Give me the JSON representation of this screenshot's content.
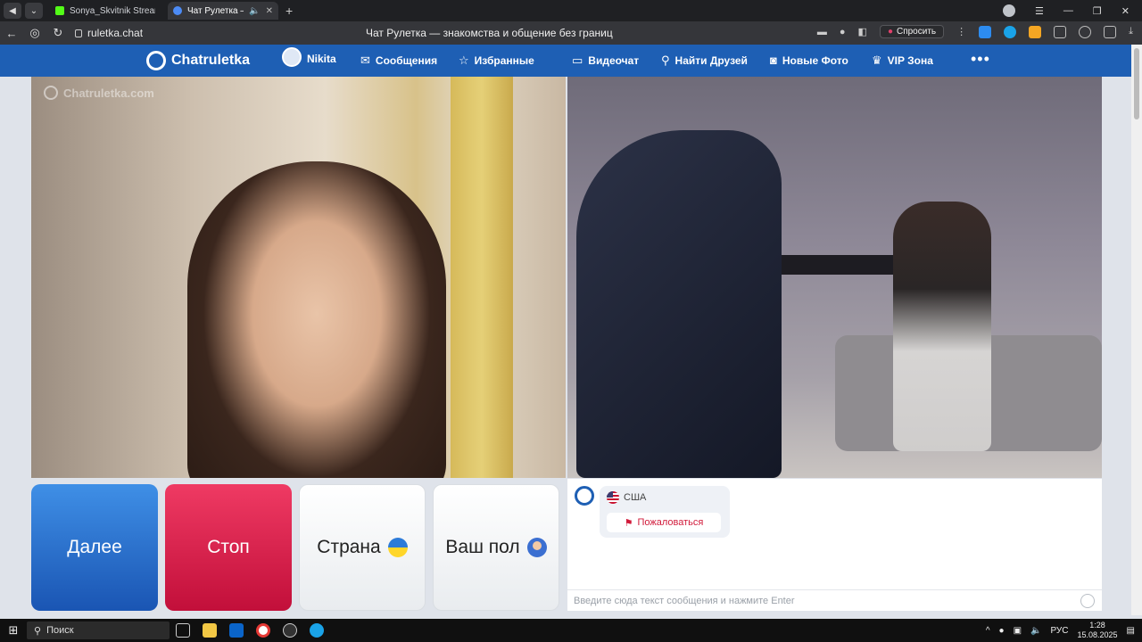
{
  "browser": {
    "tabs": [
      {
        "title": "Sonya_Skvitnik Stream - Ki",
        "active": false,
        "favicon_color": "#53fc18"
      },
      {
        "title": "Чат Рулетка — знак",
        "active": true,
        "favicon_color": "#4c8bf5"
      }
    ],
    "url": "ruletka.chat",
    "page_title": "Чат Рулетка — знакомства и общение без границ",
    "ask_label": "Спросить"
  },
  "header": {
    "logo": "Chatruletka",
    "user_name": "Nikita",
    "nav": [
      {
        "label": "Сообщения",
        "icon": "mail-icon"
      },
      {
        "label": "Избранные",
        "icon": "star-icon"
      },
      {
        "label": "Видеочат",
        "icon": "video-icon",
        "active": true
      },
      {
        "label": "Найти Друзей",
        "icon": "search-icon"
      },
      {
        "label": "Новые Фото",
        "icon": "camera-icon"
      },
      {
        "label": "VIP Зона",
        "icon": "crown-icon"
      }
    ],
    "more": "•••"
  },
  "video": {
    "watermark": "Chatruletka.com"
  },
  "controls": {
    "next": "Далее",
    "stop": "Стоп",
    "country": "Страна",
    "gender": "Ваш пол"
  },
  "chat": {
    "partner_country": "США",
    "report_label": "Пожаловаться",
    "input_placeholder": "Введите сюда текст сообщения и нажмите Enter"
  },
  "taskbar": {
    "search_label": "Поиск",
    "lang": "РУС",
    "time": "1:28",
    "date": "15.08.2025"
  },
  "colors": {
    "brand": "#1e5fb4",
    "next_button": "#2a6fd0",
    "stop_button": "#d91a47",
    "report": "#d11a3a"
  }
}
